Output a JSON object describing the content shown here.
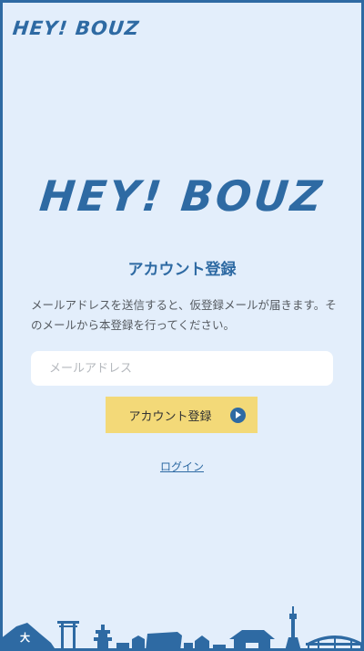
{
  "header": {
    "logo": "HEY! BOUZ"
  },
  "brand": {
    "logo": "HEY! BOUZ"
  },
  "title": "アカウント登録",
  "description": "メールアドレスを送信すると、仮登録メールが届きます。そのメールから本登録を行ってください。",
  "form": {
    "email_placeholder": "メールアドレス",
    "email_value": "",
    "submit_label": "アカウント登録"
  },
  "login_link": "ログイン",
  "colors": {
    "accent": "#2e6aa3",
    "background": "#e3eefb",
    "button": "#f3d978"
  },
  "icons": {
    "submit": "play-arrow-circle-icon",
    "footer": "city-skyline-illustration"
  }
}
